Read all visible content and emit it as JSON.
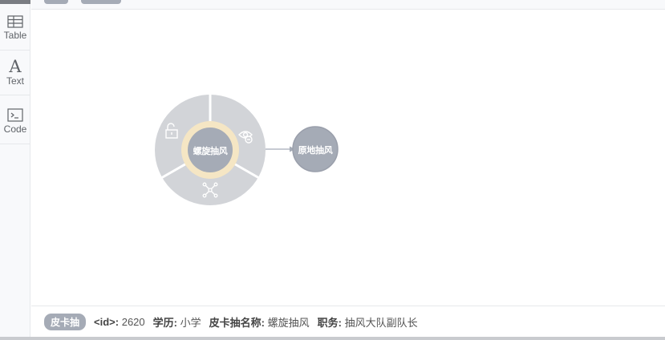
{
  "sidebar": {
    "items": [
      {
        "label": "Table",
        "icon": "table-icon"
      },
      {
        "label": "Text",
        "icon": "text-icon"
      },
      {
        "label": "Code",
        "icon": "code-icon"
      }
    ]
  },
  "graph": {
    "center_node": {
      "label": "螺旋抽风",
      "color": "#a5abb6",
      "selected_ring": "#f5e6c4"
    },
    "target_node": {
      "label": "原地抽风",
      "color": "#a5abb6"
    },
    "relationship": {
      "label": ""
    },
    "ring_actions": [
      {
        "name": "unlock",
        "icon": "unlock-icon"
      },
      {
        "name": "hide",
        "icon": "eye-hide-icon"
      },
      {
        "name": "expand",
        "icon": "expand-network-icon"
      }
    ]
  },
  "details": {
    "badge": "皮卡抽",
    "properties": [
      {
        "key": "<id>:",
        "value": "2620"
      },
      {
        "key": "学历:",
        "value": "小学"
      },
      {
        "key": "皮卡抽名称:",
        "value": "螺旋抽风"
      },
      {
        "key": "职务:",
        "value": "抽风大队副队长"
      }
    ]
  }
}
